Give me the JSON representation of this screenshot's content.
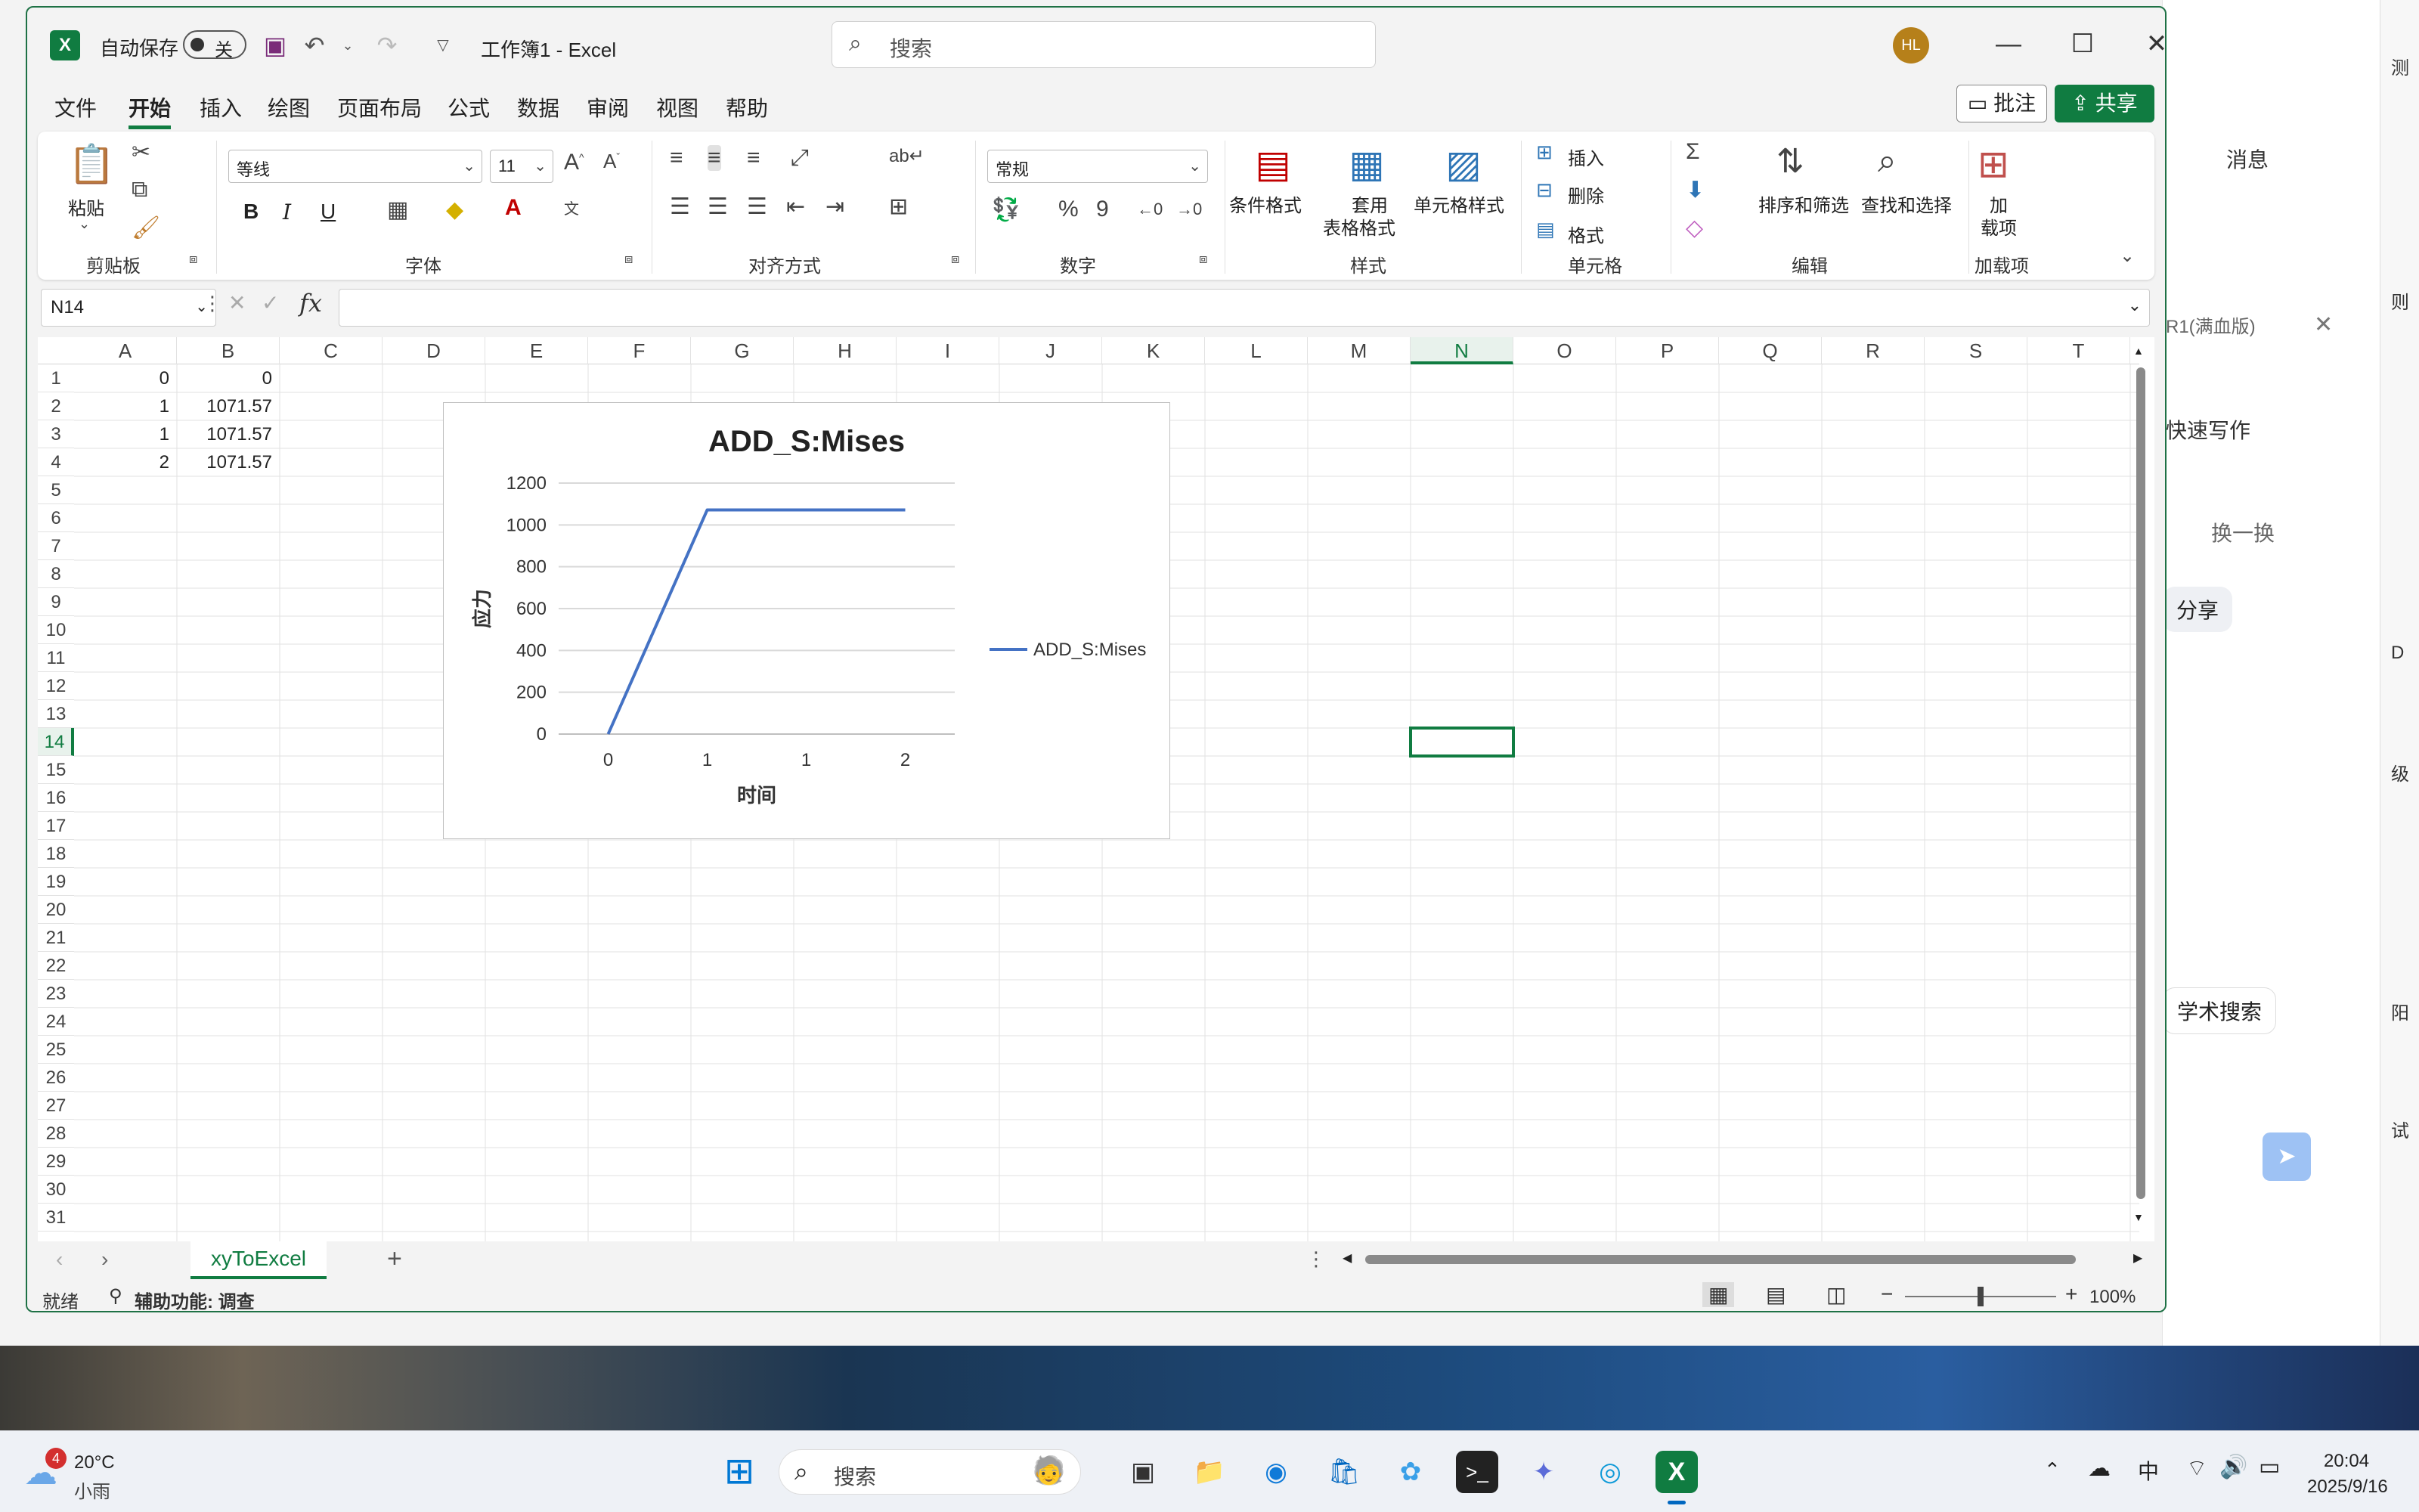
{
  "excel": {
    "autosave_label": "自动保存",
    "autosave_state": "关",
    "doc_title": "工作簿1  -  Excel",
    "search_placeholder": "搜索",
    "avatar_initials": "HL",
    "menu": [
      "文件",
      "开始",
      "插入",
      "绘图",
      "页面布局",
      "公式",
      "数据",
      "审阅",
      "视图",
      "帮助"
    ],
    "active_menu": "开始",
    "comment_label": "批注",
    "share_label": "共享",
    "ribbon": {
      "clipboard": {
        "paste": "粘贴",
        "label": "剪贴板"
      },
      "font": {
        "family": "等线",
        "size": "11",
        "bold": "B",
        "italic": "I",
        "underline": "U",
        "label": "字体"
      },
      "alignment": {
        "label": "对齐方式"
      },
      "number": {
        "format": "常规",
        "label": "数字"
      },
      "styles": {
        "conditional": "条件格式",
        "table_format_1": "套用",
        "table_format_2": "表格格式",
        "cell_styles": "单元格样式",
        "label": "样式"
      },
      "cells": {
        "insert": "插入",
        "delete": "删除",
        "format": "格式",
        "label": "单元格"
      },
      "editing": {
        "sort": "排序和筛选",
        "find": "查找和选择",
        "label": "编辑"
      },
      "addins": {
        "btn_1": "加",
        "btn_2": "载项",
        "label": "加载项"
      }
    },
    "namebox": "N14",
    "fx": "fx",
    "columns": [
      "A",
      "B",
      "C",
      "D",
      "E",
      "F",
      "G",
      "H",
      "I",
      "J",
      "K",
      "L",
      "M",
      "N",
      "O",
      "P",
      "Q",
      "R",
      "S",
      "T"
    ],
    "selected_column": "N",
    "rows": [
      "1",
      "2",
      "3",
      "4",
      "5",
      "6",
      "7",
      "8",
      "9",
      "10",
      "11",
      "12",
      "13",
      "14",
      "15",
      "16",
      "17",
      "18",
      "19",
      "20",
      "21",
      "22",
      "23",
      "24",
      "25",
      "26",
      "27",
      "28",
      "29",
      "30",
      "31"
    ],
    "selected_row": "14",
    "cells": [
      {
        "a": "0",
        "b": "0"
      },
      {
        "a": "1",
        "b": "1071.57"
      },
      {
        "a": "1",
        "b": "1071.57"
      },
      {
        "a": "2",
        "b": "1071.57"
      }
    ],
    "sheet_tab": "xyToExcel",
    "status_ready": "就绪",
    "status_accessibility": "辅助功能: 调查",
    "zoom": "100%"
  },
  "chart_data": {
    "type": "line",
    "title": "ADD_S:Mises",
    "xlabel": "时间",
    "ylabel": "应力",
    "categories": [
      "0",
      "1",
      "1",
      "2"
    ],
    "series": [
      {
        "name": "ADD_S:Mises",
        "values": [
          0,
          1071.57,
          1071.57,
          1071.57
        ],
        "color": "#4472c4"
      }
    ],
    "ylim": [
      0,
      1200
    ],
    "yticks": [
      "0",
      "200",
      "400",
      "600",
      "800",
      "1000",
      "1200"
    ],
    "grid": true,
    "legend": "right"
  },
  "background": {
    "panel_texts": [
      "消息",
      "R1(满血版)",
      "快速写作",
      "换一换",
      "分享",
      "学术搜索"
    ],
    "edge_chars": [
      "测",
      "则",
      "D",
      "级",
      "阳",
      "试"
    ]
  },
  "taskbar": {
    "weather_temp": "20°C",
    "weather_desc": "小雨",
    "weather_badge": "4",
    "search_label": "搜索",
    "ime": "中",
    "time": "20:04",
    "date": "2025/9/16"
  },
  "colors": {
    "accent": "#107c41",
    "series": "#4472c4"
  }
}
